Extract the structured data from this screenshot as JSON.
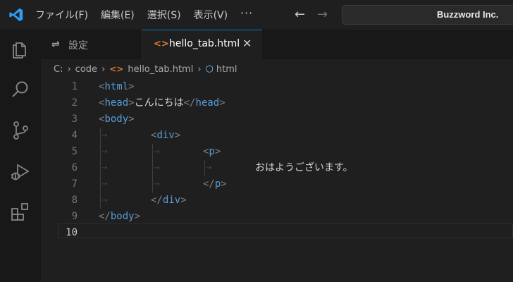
{
  "titlebar": {
    "menu": [
      "ファイル(F)",
      "編集(E)",
      "選択(S)",
      "表示(V)"
    ],
    "more": "···",
    "search": "Buzzword Inc."
  },
  "icons": {
    "app": "vscode-logo-icon",
    "explorer": "files-icon",
    "search": "search-icon",
    "scm": "source-control-icon",
    "debug": "run-debug-icon",
    "extensions": "extensions-icon"
  },
  "tabs": [
    {
      "label": "設定",
      "icon": "settings-icon",
      "active": false
    },
    {
      "label": "hello_tab.html",
      "icon": "html-file-icon",
      "active": true
    }
  ],
  "breadcrumb": [
    "C:",
    "code",
    "hello_tab.html",
    "html"
  ],
  "editor": {
    "lines": [
      {
        "n": "1",
        "parts": [
          [
            "br",
            "<"
          ],
          [
            "tag",
            "html"
          ],
          [
            "br",
            ">"
          ]
        ]
      },
      {
        "n": "2",
        "parts": [
          [
            "br",
            "<"
          ],
          [
            "tag",
            "head"
          ],
          [
            "br",
            ">"
          ],
          [
            "txt",
            "こんにちは"
          ],
          [
            "br",
            "</"
          ],
          [
            "tag",
            "head"
          ],
          [
            "br",
            ">"
          ]
        ]
      },
      {
        "n": "3",
        "parts": [
          [
            "br",
            "<"
          ],
          [
            "tag",
            "body"
          ],
          [
            "br",
            ">"
          ]
        ]
      },
      {
        "n": "4",
        "parts": [
          [
            "br",
            "<"
          ],
          [
            "tag",
            "div"
          ],
          [
            "br",
            ">"
          ]
        ]
      },
      {
        "n": "5",
        "parts": [
          [
            "br",
            "<"
          ],
          [
            "tag",
            "p"
          ],
          [
            "br",
            ">"
          ]
        ]
      },
      {
        "n": "6",
        "parts": [
          [
            "txt",
            "おはようございます。"
          ]
        ]
      },
      {
        "n": "7",
        "parts": [
          [
            "br",
            "</"
          ],
          [
            "tag",
            "p"
          ],
          [
            "br",
            ">"
          ]
        ]
      },
      {
        "n": "8",
        "parts": [
          [
            "br",
            "</"
          ],
          [
            "tag",
            "div"
          ],
          [
            "br",
            ">"
          ]
        ]
      },
      {
        "n": "9",
        "parts": [
          [
            "br",
            "</"
          ],
          [
            "tag",
            "body"
          ],
          [
            "br",
            ">"
          ]
        ]
      },
      {
        "n": "10",
        "parts": []
      }
    ],
    "active_line": "10"
  },
  "colors": {
    "accent": "#0078d4",
    "tag": "#569cd6",
    "bracket": "#808080",
    "html_icon": "#e37933"
  }
}
